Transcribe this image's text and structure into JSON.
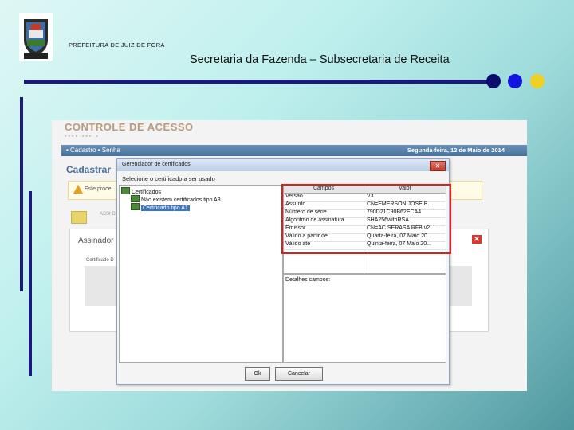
{
  "header": {
    "organization": "PREFEITURA DE JUIZ DE FORA",
    "slide_title": "Secretaria da Fazenda – Subsecretaria de Receita",
    "colors": {
      "line": "#1a1a7a",
      "dot1": "#0c0c6e",
      "dot2": "#1414e0",
      "dot3": "#f0d020"
    }
  },
  "app": {
    "title": "CONTROLE DE ACESSO",
    "nav": {
      "items": "• Cadastro  • Senha",
      "date": "Segunda-feira, 12 de Maio de 2014"
    },
    "page_title": "Cadastrar",
    "warning": "Este proce",
    "assign_text": "ASSI DIGI",
    "assinador": {
      "title": "Assinador",
      "field_label": "Certificado D"
    }
  },
  "dialog": {
    "title": "Gerenciador de certificados",
    "select_label": "Selecione o certificado a ser usado",
    "tree": {
      "root": "Certificados",
      "items": [
        "Não existem certificados tipo A3",
        "Certificado tipo A1"
      ]
    },
    "grid": {
      "headers": [
        "Campos",
        "Valor"
      ],
      "rows": [
        {
          "field": "Versão",
          "value": "V3"
        },
        {
          "field": "Assunto",
          "value": "CN=EMERSON JOSE B."
        },
        {
          "field": "Número de série",
          "value": "790D21C90B62ECA4"
        },
        {
          "field": "Algoritmo de assinatura",
          "value": "SHA256withRSA"
        },
        {
          "field": "Emissor",
          "value": "CN=AC SERASA RFB v2..."
        },
        {
          "field": "Válido a partir de",
          "value": "Quarta-feira, 07 Maio 20..."
        },
        {
          "field": "Válido até",
          "value": "Quinta-feira, 07 Maio 20..."
        }
      ]
    },
    "details_label": "Detalhes campos:",
    "buttons": {
      "ok": "Ok",
      "cancel": "Cancelar"
    },
    "highlight_color": "#e01d1d"
  }
}
